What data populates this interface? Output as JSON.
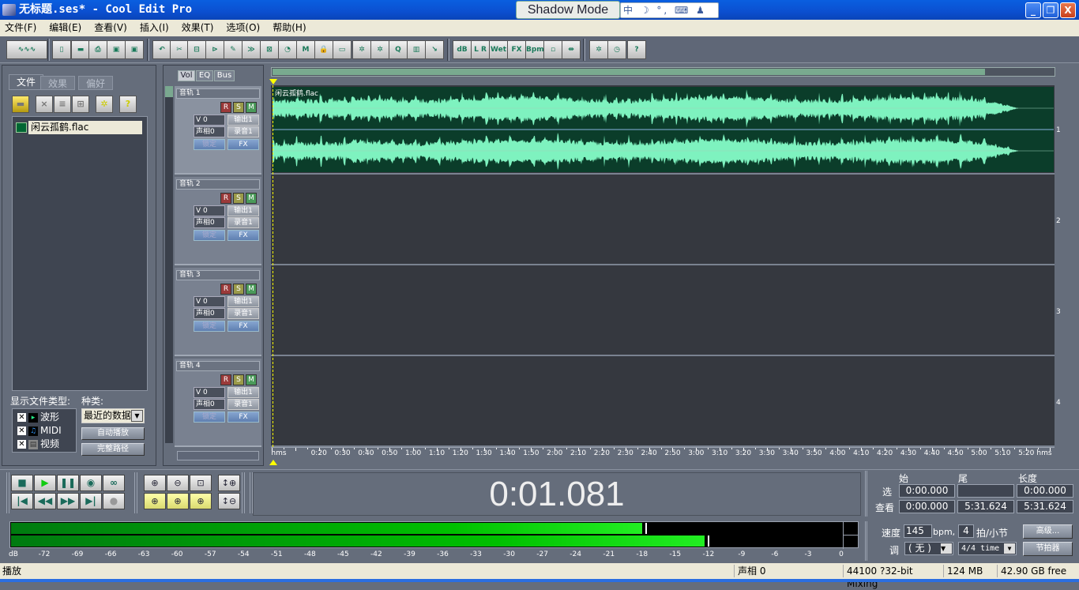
{
  "window": {
    "title": "无标题.ses* - Cool Edit Pro",
    "overlay": "Shadow Mode",
    "ime": "中 ☽ °, ⌨ ♟ ✎",
    "minimize": "_",
    "restore": "❐",
    "close": "X"
  },
  "menu": [
    "文件(F)",
    "编辑(E)",
    "查看(V)",
    "插入(I)",
    "效果(T)",
    "选项(O)",
    "帮助(H)"
  ],
  "toolbar": {
    "icons": [
      "waveform-view",
      "new-file",
      "open-file",
      "print",
      "save",
      "save-as",
      "undo",
      "cut",
      "crop",
      "trim",
      "envelope",
      "mix-paste",
      "cross",
      "loop",
      "insert-midi",
      "lock",
      "group",
      "punch-in",
      "loop-duplicate",
      "quantize",
      "metronome",
      "snap",
      "db",
      "pan",
      "wet",
      "fx",
      "bpm",
      "track-link",
      "clip-split",
      "settings",
      "schedule",
      "help"
    ],
    "labels": {
      "db": "dB",
      "pan": "L R",
      "wet": "Wet",
      "fx": "FX",
      "bpm": "Bpm"
    }
  },
  "left_panel": {
    "tabs": [
      "文件",
      "效果",
      "偏好"
    ],
    "active_tab": "文件",
    "tool_icons": [
      "open",
      "close",
      "insert",
      "insert-multitrack",
      "options",
      "help"
    ],
    "files": [
      "闲云孤鹤.flac"
    ],
    "file_type_label": "显示文件类型:",
    "file_types": [
      {
        "label": "波形",
        "checked": true
      },
      {
        "label": "MIDI",
        "checked": true
      },
      {
        "label": "视频",
        "checked": true
      }
    ],
    "sort_label": "种类:",
    "sort_value": "最近的数据",
    "autoplay": "自动播放",
    "full_path": "完整路径"
  },
  "track_tabs": [
    "Vol",
    "EQ",
    "Bus"
  ],
  "tracks": [
    {
      "name": "音轨 1",
      "volume": "V 0",
      "pan": "声相0",
      "output": "输出1",
      "record": "录音1",
      "lock": "锁定",
      "fx": "FX",
      "number": "1"
    },
    {
      "name": "音轨 2",
      "volume": "V 0",
      "pan": "声相0",
      "output": "输出1",
      "record": "录音1",
      "lock": "锁定",
      "fx": "FX",
      "number": "2"
    },
    {
      "name": "音轨 3",
      "volume": "V 0",
      "pan": "声相0",
      "output": "输出1",
      "record": "录音1",
      "lock": "锁定",
      "fx": "FX",
      "number": "3"
    },
    {
      "name": "音轨 4",
      "volume": "V 0",
      "pan": "声相0",
      "output": "输出1",
      "record": "录音1",
      "lock": "锁定",
      "fx": "FX",
      "number": "4"
    }
  ],
  "rsm": [
    "R",
    "S",
    "M"
  ],
  "colors": {
    "record": "#9a3a3a",
    "solo": "#9a9a4a",
    "mute": "#4a9a5a",
    "wave": "#7ef2bf",
    "clip_bg": "#0b3d2a",
    "meter": "#00cc00"
  },
  "clip": {
    "name": "闲云孤鹤.flac",
    "track": 1
  },
  "ruler": {
    "unit": "hms",
    "labels": [
      "0:20",
      "0:30",
      "0:40",
      "0:50",
      "1:00",
      "1:10",
      "1:20",
      "1:30",
      "1:40",
      "1:50",
      "2:00",
      "2:10",
      "2:20",
      "2:30",
      "2:40",
      "2:50",
      "3:00",
      "3:10",
      "3:20",
      "3:30",
      "3:40",
      "3:50",
      "4:00",
      "4:10",
      "4:20",
      "4:30",
      "4:40",
      "4:50",
      "5:00",
      "5:10",
      "5:20"
    ]
  },
  "overview_fraction": 0.91,
  "transport": {
    "buttons": [
      "stop",
      "play",
      "pause",
      "play-from-cursor",
      "loop",
      "go-to-start",
      "rewind",
      "fast-forward",
      "go-to-end",
      "record"
    ],
    "zoom_buttons": [
      "zoom-in",
      "zoom-out",
      "zoom-full",
      "zoom-in-vertical",
      "zoom-left",
      "zoom-right",
      "zoom-selection",
      "zoom-out-vertical"
    ]
  },
  "time_display": "0:01.081",
  "selection": {
    "headers": [
      "始",
      "尾",
      "长度"
    ],
    "rows": [
      {
        "label": "选",
        "start": "0:00.000",
        "end": "",
        "length": "0:00.000"
      },
      {
        "label": "查看",
        "start": "0:00.000",
        "end": "5:31.624",
        "length": "5:31.624"
      }
    ]
  },
  "tempo": {
    "label": "速度",
    "value": "145",
    "unit": "bpm,",
    "beats": "4",
    "beats_label": "拍/小节",
    "key_label": "调",
    "key": "( 无 )",
    "time_sig": "4/4 time",
    "advanced": "高级...",
    "metronome": "节拍器"
  },
  "meter": {
    "labels": [
      "dB",
      "-72",
      "-69",
      "-66",
      "-63",
      "-60",
      "-57",
      "-54",
      "-51",
      "-48",
      "-45",
      "-42",
      "-39",
      "-36",
      "-33",
      "-30",
      "-27",
      "-24",
      "-21",
      "-18",
      "-15",
      "-12",
      "-9",
      "-6",
      "-3",
      "0"
    ],
    "left_db": -18.1,
    "left_peak_db": -17.8,
    "right_db": -12.5,
    "right_peak_db": -12.1
  },
  "status": {
    "state": "播放",
    "pan": "声相 0",
    "format": "44100 ?32-bit Mixing",
    "memory": "124 MB",
    "disk": "42.90 GB free"
  }
}
